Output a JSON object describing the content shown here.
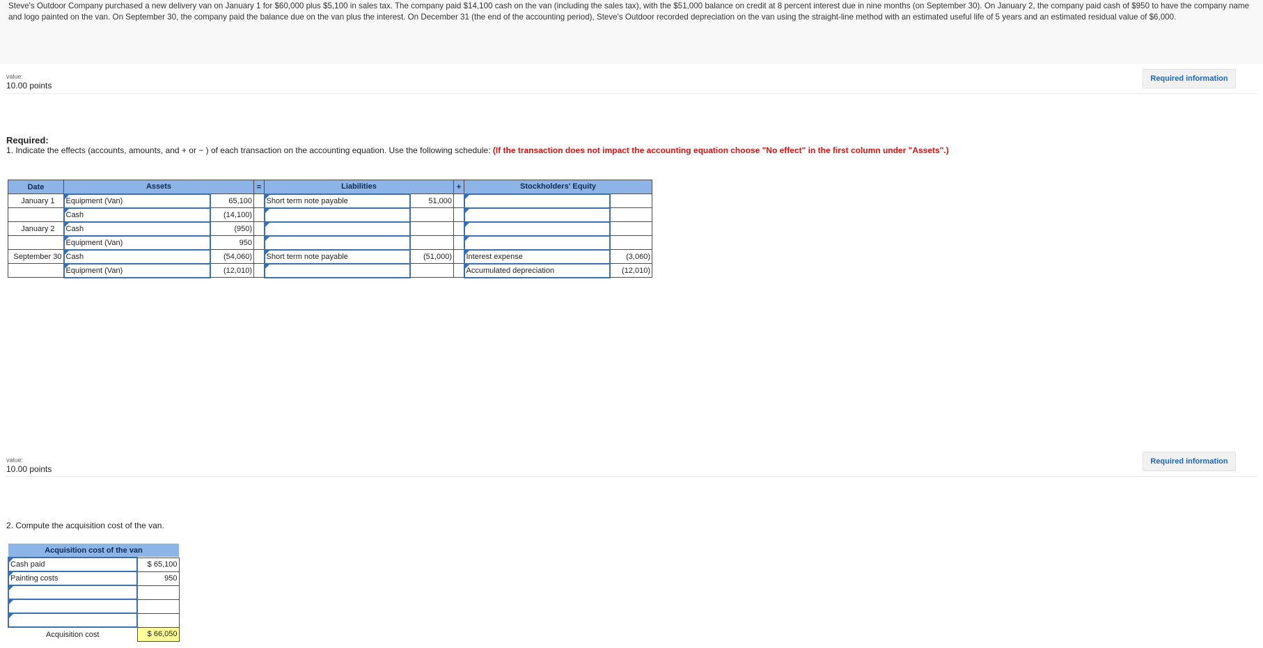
{
  "problem_text": "Steve's Outdoor Company purchased a new delivery van on January 1 for $60,000 plus $5,100 in sales tax. The company paid $14,100 cash on the van (including the sales tax), with the $51,000 balance on credit at 8 percent interest due in nine months (on September 30).  On January 2, the company paid cash of $950 to have the company name and logo painted on the van.  On September 30, the company paid the balance due on the van plus the interest. On December 31 (the end of the accounting period), Steve's Outdoor recorded depreciation on the van using the straight-line method with an estimated useful life of 5 years and an estimated residual value of $6,000.",
  "value_label": "value:",
  "value_points": "10.00 points",
  "required_info_label": "Required information",
  "required": {
    "heading": "Required:",
    "instruction": "1. Indicate the effects (accounts, amounts, and + or − ) of each transaction on the accounting equation. Use the following schedule: ",
    "note": "(If the transaction does not impact the accounting equation choose \"No effect\" in the first column under \"Assets\".)"
  },
  "schedule": {
    "headers": {
      "date": "Date",
      "assets": "Assets",
      "equals": "=",
      "liabilities": "Liabilities",
      "plus": "+",
      "equity": "Stockholders' Equity"
    },
    "rows": [
      {
        "date": "January 1",
        "asset": "Equipment (Van)",
        "asset_amt": "65,100",
        "liab": "Short term note payable",
        "liab_amt": "51,000",
        "equity": "",
        "equity_amt": ""
      },
      {
        "date": "",
        "asset": "Cash",
        "asset_amt": "(14,100)",
        "liab": "",
        "liab_amt": "",
        "equity": "",
        "equity_amt": ""
      },
      {
        "date": "January 2",
        "asset": "Cash",
        "asset_amt": "(950)",
        "liab": "",
        "liab_amt": "",
        "equity": "",
        "equity_amt": ""
      },
      {
        "date": "",
        "asset": "Equipment (Van)",
        "asset_amt": "950",
        "liab": "",
        "liab_amt": "",
        "equity": "",
        "equity_amt": ""
      },
      {
        "date": "September 30",
        "asset": "Cash",
        "asset_amt": "(54,060)",
        "liab": "Short term note payable",
        "liab_amt": "(51,000)",
        "equity": "Interest expense",
        "equity_amt": "(3,060)"
      },
      {
        "date": "",
        "asset": "Equipment (Van)",
        "asset_amt": "(12,010)",
        "liab": "",
        "liab_amt": "",
        "equity": "Accumulated depreciation",
        "equity_amt": "(12,010)"
      }
    ]
  },
  "q2_text": "2. Compute the acquisition cost of the van.",
  "acquisition": {
    "header": "Acquisition cost of the van",
    "rows": [
      {
        "label": "Cash paid",
        "amount": "$ 65,100"
      },
      {
        "label": "Painting costs",
        "amount": "950"
      },
      {
        "label": "",
        "amount": ""
      },
      {
        "label": "",
        "amount": ""
      },
      {
        "label": "",
        "amount": ""
      }
    ],
    "total_label": "Acquisition cost",
    "total_amount": "$ 66,050"
  }
}
